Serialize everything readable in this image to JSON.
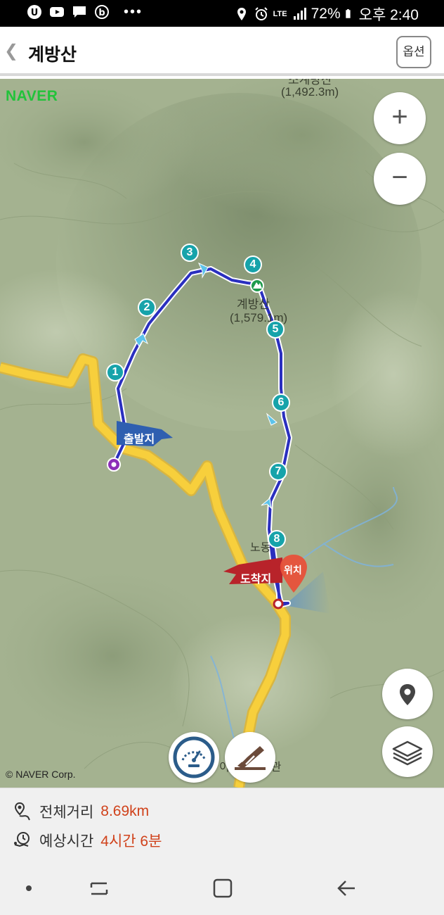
{
  "status_bar": {
    "battery": "72%",
    "time": "오후 2:40",
    "network": "LTE",
    "icons": [
      "u-plus-icon",
      "youtube-icon",
      "message-icon",
      "b-app-icon",
      "more-icon",
      "location-icon",
      "alarm-icon",
      "signal-icon",
      "battery-icon"
    ]
  },
  "header": {
    "back_icon": "chevron-left-icon",
    "title": "계방산",
    "options_label": "옵션"
  },
  "map": {
    "provider_logo": "NAVER",
    "copyright": "© NAVER Corp.",
    "labels": {
      "top_peak_name": "소계방산",
      "top_peak_elevation": "(1,492.3m)",
      "main_peak_name": "계방산",
      "main_peak_elevation": "(1,579.1m)",
      "end_area": "노동",
      "bottom_place": "이승복기념관"
    },
    "start_flag": "출발지",
    "end_flag": "도착지",
    "location_pin": "위치",
    "waypoints": [
      "1",
      "2",
      "3",
      "4",
      "5",
      "6",
      "7",
      "8"
    ],
    "controls": {
      "zoom_in": "+",
      "zoom_out": "−",
      "locate_icon": "map-pin-icon",
      "layers_icon": "layers-icon",
      "speedometer_icon": "speedometer-icon",
      "profile_icon": "elevation-profile-icon"
    },
    "colors": {
      "route": "#2a2fbf",
      "road": "#f7cf3c",
      "waypoint": "#16a3aa",
      "start_flag": "#2f5fb0",
      "end_flag": "#b8232a",
      "brand": "#22c33a"
    }
  },
  "summary": {
    "distance_label": "전체거리",
    "distance_value": "8.69km",
    "time_label": "예상시간",
    "time_value": "4시간 6분",
    "value_color": "#d0421b"
  },
  "nav_bar": {
    "icons": [
      "dot-icon",
      "recent-apps-icon",
      "home-icon",
      "back-icon"
    ]
  }
}
